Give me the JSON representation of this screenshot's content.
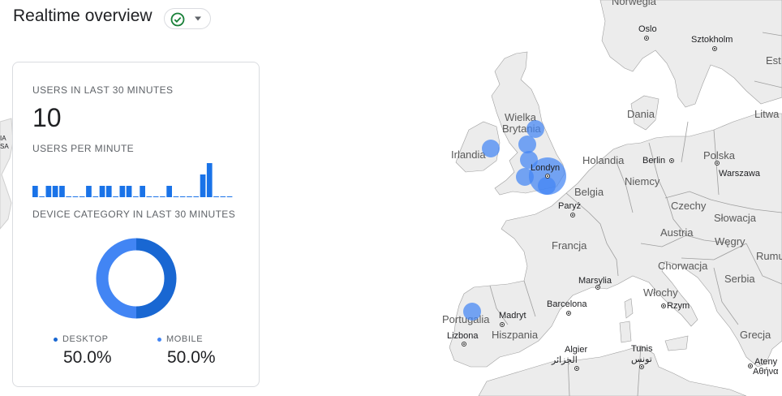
{
  "header": {
    "title": "Realtime overview",
    "status_icon": "check-circle-icon",
    "menu_icon": "caret-down-icon"
  },
  "card": {
    "users_label": "USERS IN LAST 30 MINUTES",
    "users_value": "10",
    "per_minute_label": "USERS PER MINUTE",
    "device_label": "DEVICE CATEGORY IN LAST 30 MINUTES",
    "legend": [
      {
        "name": "DESKTOP",
        "value": "50.0%",
        "color": "#1967d2"
      },
      {
        "name": "MOBILE",
        "value": "50.0%",
        "color": "#4285f4"
      }
    ]
  },
  "chart_data": [
    {
      "type": "bar",
      "title": "USERS PER MINUTE",
      "values": [
        1,
        0,
        1,
        1,
        1,
        0,
        0,
        0,
        1,
        0,
        1,
        1,
        0,
        1,
        1,
        0,
        1,
        0,
        0,
        0,
        1,
        0,
        0,
        0,
        0,
        2,
        3,
        0,
        0,
        0
      ],
      "ylim": [
        0,
        3
      ]
    },
    {
      "type": "pie",
      "title": "DEVICE CATEGORY IN LAST 30 MINUTES",
      "categories": [
        "DESKTOP",
        "MOBILE"
      ],
      "values": [
        50.0,
        50.0
      ]
    }
  ],
  "map": {
    "colors": {
      "water": "#ffffff",
      "land": "#ececec",
      "border": "#9e9e9e",
      "bubble": "#4285f4"
    },
    "labels": {
      "norway": "Norwegia",
      "oslo": "Oslo",
      "stockholm": "Sztokholm",
      "est": "Est",
      "denmark": "Dania",
      "lithuania": "Litwa",
      "uk1": "Wielka",
      "uk2": "Brytania",
      "ireland": "Irlandia",
      "netherlands": "Holandia",
      "berlin": "Berlin",
      "poland": "Polska",
      "warsaw": "Warszawa",
      "london": "Londyn",
      "germany": "Niemcy",
      "belgium": "Belgia",
      "czech": "Czechy",
      "paris": "Paryż",
      "slovakia": "Słowacja",
      "austria": "Austria",
      "france": "Francja",
      "hungary": "Węgry",
      "croatia": "Chorwacja",
      "romania": "Rumu",
      "serbia": "Serbia",
      "marseille": "Marsylia",
      "italy": "Włochy",
      "rome": "Rzym",
      "barcelona": "Barcelona",
      "madrid": "Madryt",
      "portugal": "Portugalia",
      "spain": "Hiszpania",
      "lisbon": "Lizbona",
      "greece": "Grecja",
      "algiers": "Algier",
      "algiers_ar": "الجزائر",
      "tunis": "Tunis",
      "tunis_ar": "تونس",
      "athens": "Ateny",
      "athens_gr": "Αθήνα",
      "sa": "SA",
      "ia": "IA"
    }
  }
}
